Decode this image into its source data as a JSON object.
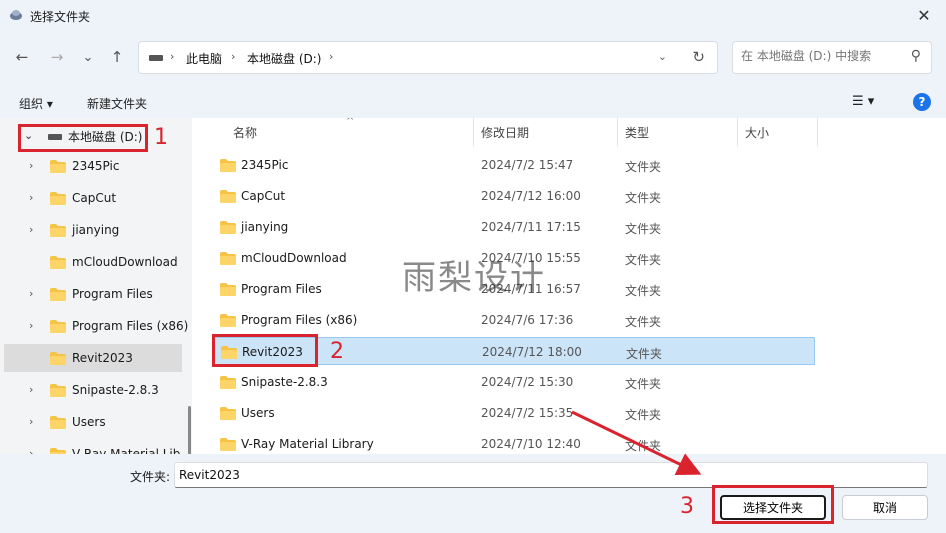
{
  "window": {
    "title": "选择文件夹",
    "close_glyph": "✕"
  },
  "nav": {
    "back_glyph": "←",
    "forward_glyph": "→",
    "dropdown_glyph": "⌄",
    "up_glyph": "↑",
    "address": {
      "crumbs": [
        "此电脑",
        "本地磁盘 (D:)"
      ],
      "sep_glyph": "›",
      "dd_glyph": "⌄",
      "refresh_glyph": "↻"
    },
    "search_placeholder": "在 本地磁盘 (D:) 中搜索",
    "search_glyph": "⚲"
  },
  "toolbar": {
    "organize": "组织 ▾",
    "new_folder": "新建文件夹",
    "view_glyph": "☰ ▾",
    "help_glyph": "?"
  },
  "sidebar": {
    "drive": {
      "label": "本地磁盘 (D:)",
      "chev": "⌄"
    },
    "items": [
      {
        "label": "2345Pic",
        "chev": "›"
      },
      {
        "label": "CapCut",
        "chev": "›"
      },
      {
        "label": "jianying",
        "chev": "›"
      },
      {
        "label": "mCloudDownload",
        "chev": ""
      },
      {
        "label": "Program Files",
        "chev": "›"
      },
      {
        "label": "Program Files (x86)",
        "chev": "›"
      },
      {
        "label": "Revit2023",
        "chev": ""
      },
      {
        "label": "Snipaste-2.8.3",
        "chev": "›"
      },
      {
        "label": "Users",
        "chev": "›"
      },
      {
        "label": "V-Ray Material Lib",
        "chev": "›"
      }
    ]
  },
  "columns": {
    "name": "名称",
    "modified": "修改日期",
    "type": "类型",
    "size": "大小",
    "sort_glyph": "^"
  },
  "files": [
    {
      "name": "2345Pic",
      "date": "2024/7/2 15:47",
      "type": "文件夹"
    },
    {
      "name": "CapCut",
      "date": "2024/7/12 16:00",
      "type": "文件夹"
    },
    {
      "name": "jianying",
      "date": "2024/7/11 17:15",
      "type": "文件夹"
    },
    {
      "name": "mCloudDownload",
      "date": "2024/7/10 15:55",
      "type": "文件夹"
    },
    {
      "name": "Program Files",
      "date": "2024/7/11 16:57",
      "type": "文件夹"
    },
    {
      "name": "Program Files (x86)",
      "date": "2024/7/6 17:36",
      "type": "文件夹"
    },
    {
      "name": "Revit2023",
      "date": "2024/7/12 18:00",
      "type": "文件夹"
    },
    {
      "name": "Snipaste-2.8.3",
      "date": "2024/7/2 15:30",
      "type": "文件夹"
    },
    {
      "name": "Users",
      "date": "2024/7/2 15:35",
      "type": "文件夹"
    },
    {
      "name": "V-Ray Material Library",
      "date": "2024/7/10 12:40",
      "type": "文件夹"
    }
  ],
  "footer": {
    "folder_label": "文件夹:",
    "folder_value": "Revit2023",
    "select_button": "选择文件夹",
    "cancel_button": "取消"
  },
  "watermark": "雨梨设计",
  "annotations": {
    "one": "1",
    "two": "2",
    "three": "3"
  },
  "colors": {
    "accent": "#1a73e8",
    "selection": "#cce4f7",
    "annotation_red": "#d9232d",
    "folder": "#f6c344"
  }
}
